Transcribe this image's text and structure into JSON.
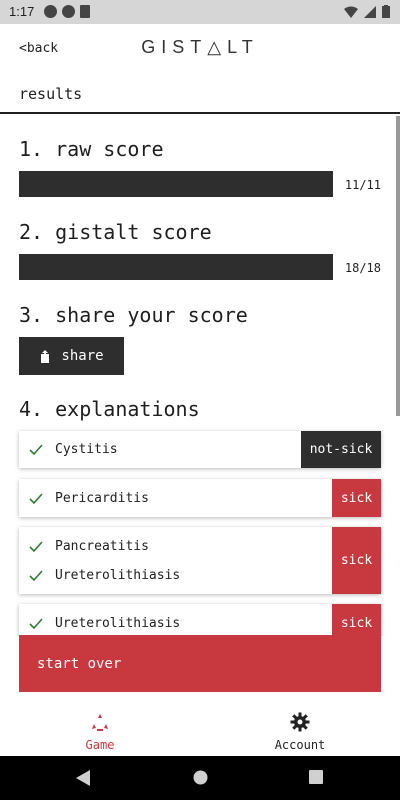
{
  "status_bar": {
    "time": "1:17"
  },
  "header": {
    "back_label": "<back",
    "brand": "GIST△LT",
    "title": "results"
  },
  "sections": {
    "raw_score": {
      "heading": "1. raw score",
      "score_text": "11/11",
      "fraction": 1.0
    },
    "gistalt_score": {
      "heading": "2. gistalt score",
      "score_text": "18/18",
      "fraction": 1.0
    },
    "share": {
      "heading": "3. share your score",
      "button_label": "share"
    },
    "explanations": {
      "heading": "4. explanations"
    }
  },
  "explanations": [
    {
      "items": [
        "Cystitis"
      ],
      "tag": "not-sick"
    },
    {
      "items": [
        "Pericarditis"
      ],
      "tag": "sick"
    },
    {
      "items": [
        "Pancreatitis",
        "Ureterolithiasis"
      ],
      "tag": "sick"
    },
    {
      "items": [
        "Ureterolithiasis"
      ],
      "tag": "sick"
    }
  ],
  "actions": {
    "start_over": "start over"
  },
  "bottom_nav": {
    "game": "Game",
    "account": "Account"
  },
  "colors": {
    "accent": "#c8393f",
    "dark": "#2e2e2e",
    "check": "#2e7d32"
  }
}
